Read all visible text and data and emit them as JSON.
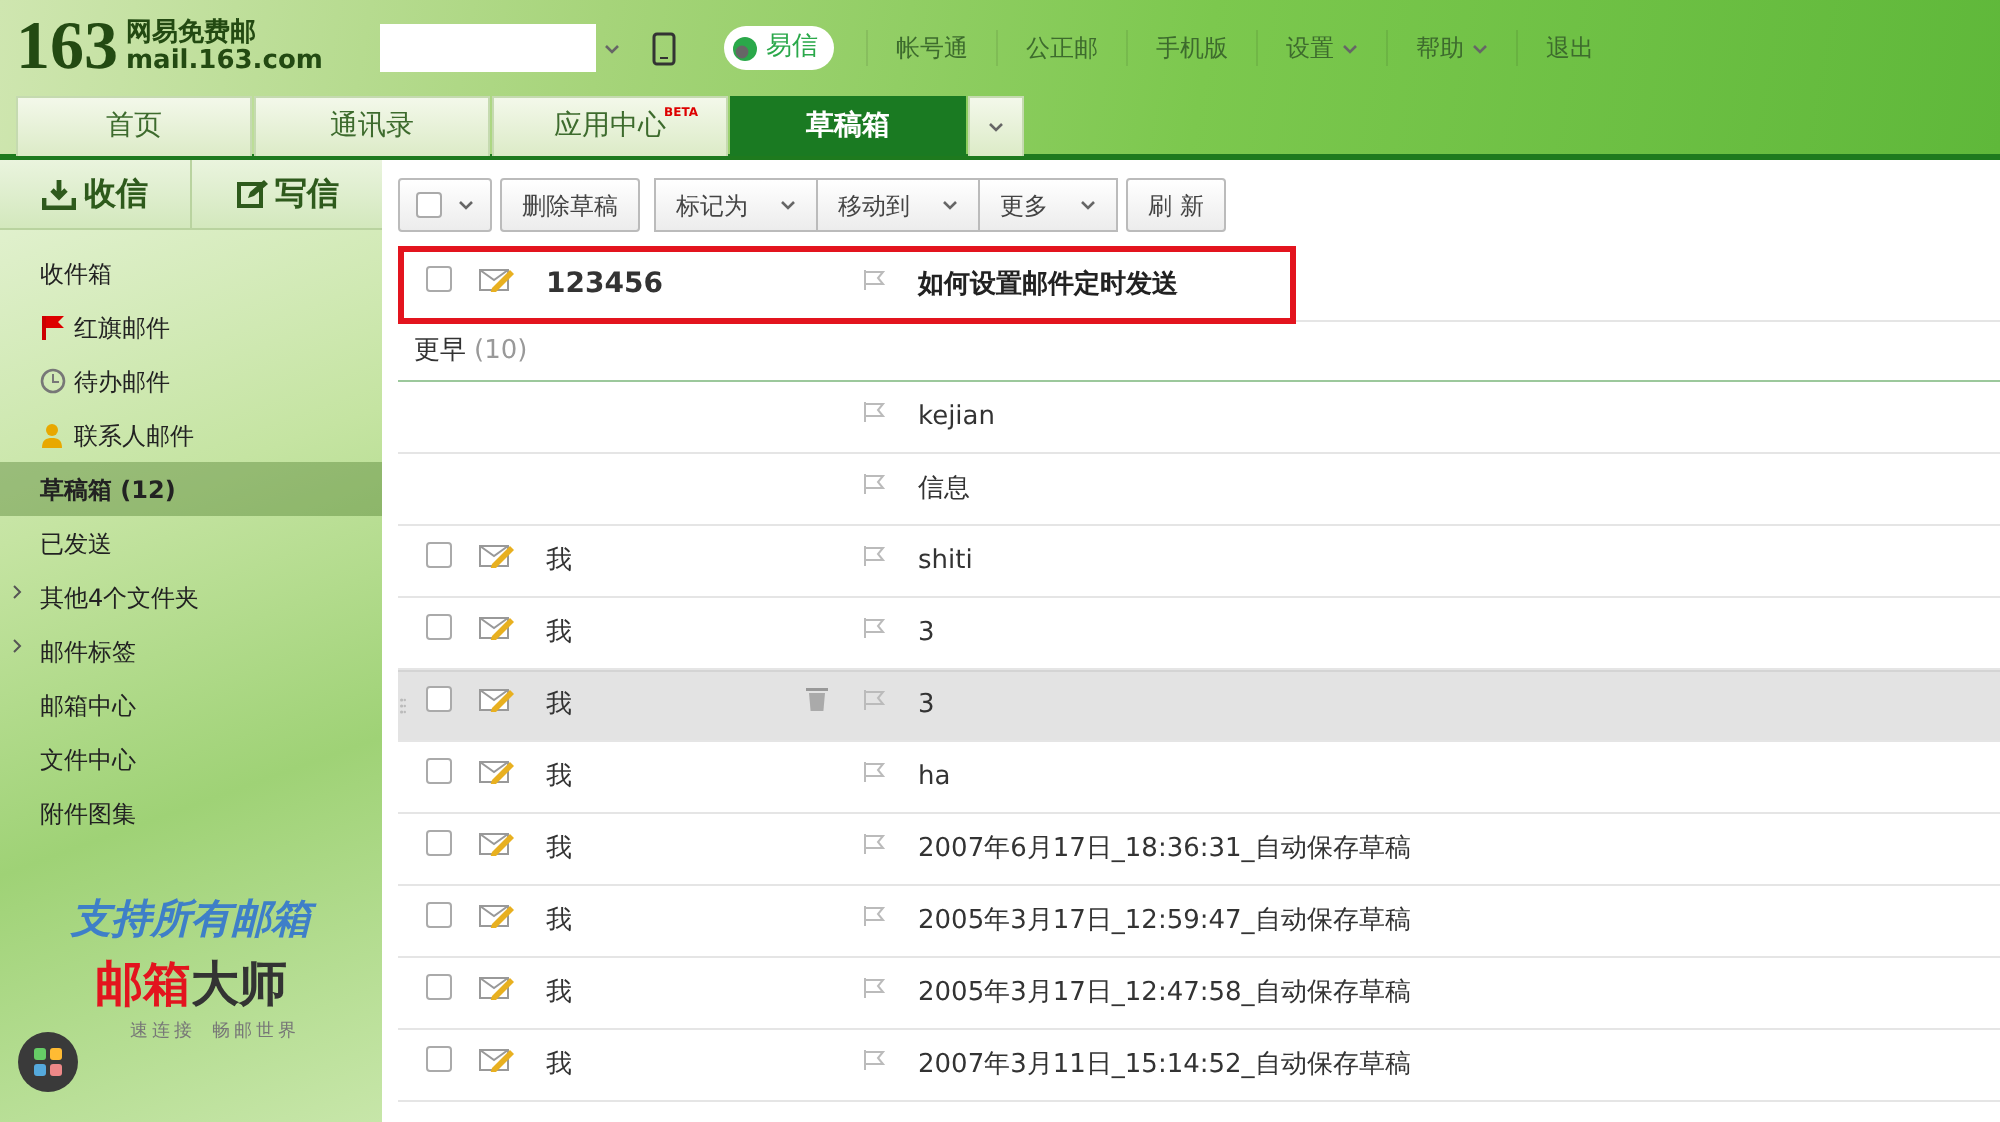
{
  "header": {
    "logo_number": "163",
    "logo_name": "网易免费邮",
    "logo_domain": "mail.163.com",
    "yixin": "易信",
    "links": [
      {
        "label": "帐号通",
        "dropdown": false
      },
      {
        "label": "公正邮",
        "dropdown": false
      },
      {
        "label": "手机版",
        "dropdown": false
      },
      {
        "label": "设置",
        "dropdown": true
      },
      {
        "label": "帮助",
        "dropdown": true
      },
      {
        "label": "退出",
        "dropdown": false
      }
    ]
  },
  "tabs": [
    {
      "label": "首页",
      "selected": false
    },
    {
      "label": "通讯录",
      "selected": false
    },
    {
      "label": "应用中心",
      "badge": "BETA",
      "selected": false
    },
    {
      "label": "草稿箱",
      "selected": true
    }
  ],
  "compose": [
    {
      "kind": "receive",
      "label": "收信"
    },
    {
      "kind": "write",
      "label": "写信"
    }
  ],
  "folders": [
    {
      "label": "收件箱",
      "kind": "plain",
      "selected": false,
      "expandable": false
    },
    {
      "label": "红旗邮件",
      "kind": "flagged",
      "selected": false,
      "expandable": false
    },
    {
      "label": "待办邮件",
      "kind": "todo",
      "selected": false,
      "expandable": false
    },
    {
      "label": "联系人邮件",
      "kind": "contacts",
      "selected": false,
      "expandable": false
    },
    {
      "label": "草稿箱 (12)",
      "kind": "plain",
      "selected": true,
      "expandable": false
    },
    {
      "label": "已发送",
      "kind": "plain",
      "selected": false,
      "expandable": false
    },
    {
      "label": "其他4个文件夹",
      "kind": "plain",
      "selected": false,
      "expandable": true
    },
    {
      "label": "邮件标签",
      "kind": "plain",
      "selected": false,
      "expandable": true
    },
    {
      "label": "邮箱中心",
      "kind": "plain",
      "selected": false,
      "expandable": false
    },
    {
      "label": "文件中心",
      "kind": "plain",
      "selected": false,
      "expandable": false
    },
    {
      "label": "附件图集",
      "kind": "plain",
      "selected": false,
      "expandable": false
    }
  ],
  "promo": {
    "slogan": "支持所有邮箱",
    "brand_red": "邮箱",
    "brand_dark": "大师",
    "tagline_1": "速连接",
    "tagline_2": "畅邮世界"
  },
  "toolbar": [
    {
      "kind": "select"
    },
    {
      "kind": "button",
      "label": "删除草稿"
    },
    {
      "kind": "group",
      "items": [
        "标记为",
        "移动到",
        "更多"
      ]
    },
    {
      "kind": "button",
      "label": "刷 新"
    }
  ],
  "messages": [
    {
      "sender": "123456",
      "subject": "如何设置邮件定时发送",
      "checked": false,
      "bold": true,
      "hovered": false,
      "annotated": true
    }
  ],
  "group": {
    "label": "更早",
    "count": "(10)"
  },
  "earlier": [
    {
      "subject": "kejian",
      "hovered": false
    },
    {
      "subject": "信息",
      "hovered": false
    },
    {
      "sender": "我",
      "subject": "shiti",
      "checked": false,
      "hovered": false
    },
    {
      "sender": "我",
      "subject": "3",
      "checked": false,
      "hovered": false
    },
    {
      "sender": "我",
      "subject": "3",
      "checked": false,
      "hovered": true
    },
    {
      "sender": "我",
      "subject": "ha",
      "checked": false,
      "hovered": false
    },
    {
      "sender": "我",
      "subject": "2007年6月17日_18:36:31_自动保存草稿",
      "checked": false,
      "hovered": false
    },
    {
      "sender": "我",
      "subject": "2005年3月17日_12:59:47_自动保存草稿",
      "checked": false,
      "hovered": false
    },
    {
      "sender": "我",
      "subject": "2005年3月17日_12:47:58_自动保存草稿",
      "checked": false,
      "hovered": false
    },
    {
      "sender": "我",
      "subject": "2007年3月11日_15:14:52_自动保存草稿",
      "checked": false,
      "hovered": false
    }
  ]
}
